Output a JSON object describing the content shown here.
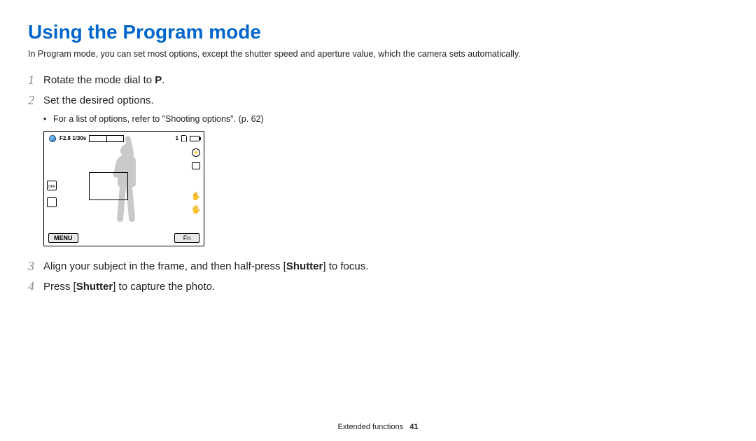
{
  "title": "Using the Program mode",
  "intro": "In Program mode, you can set most options, except the shutter speed and aperture value, which the camera sets automatically.",
  "steps": {
    "s1_pre": "Rotate the mode dial to ",
    "s1_icon": "P",
    "s1_post": ".",
    "s2": "Set the desired options.",
    "s2_note": "For a list of options, refer to \"Shooting options\". (p. 62)",
    "s3_pre": "Align your subject in the frame, and then half-press [",
    "s3_bold": "Shutter",
    "s3_post": "] to focus.",
    "s4_pre": "Press [",
    "s4_bold": "Shutter",
    "s4_post": "] to capture the photo."
  },
  "nums": {
    "n1": "1",
    "n2": "2",
    "n3": "3",
    "n4": "4"
  },
  "lcd": {
    "exposure": "F2.8 1/30s",
    "count": "1",
    "menu": "MENU",
    "fn": "Fn",
    "off": "OFF"
  },
  "footer": {
    "section": "Extended functions",
    "page": "41"
  }
}
